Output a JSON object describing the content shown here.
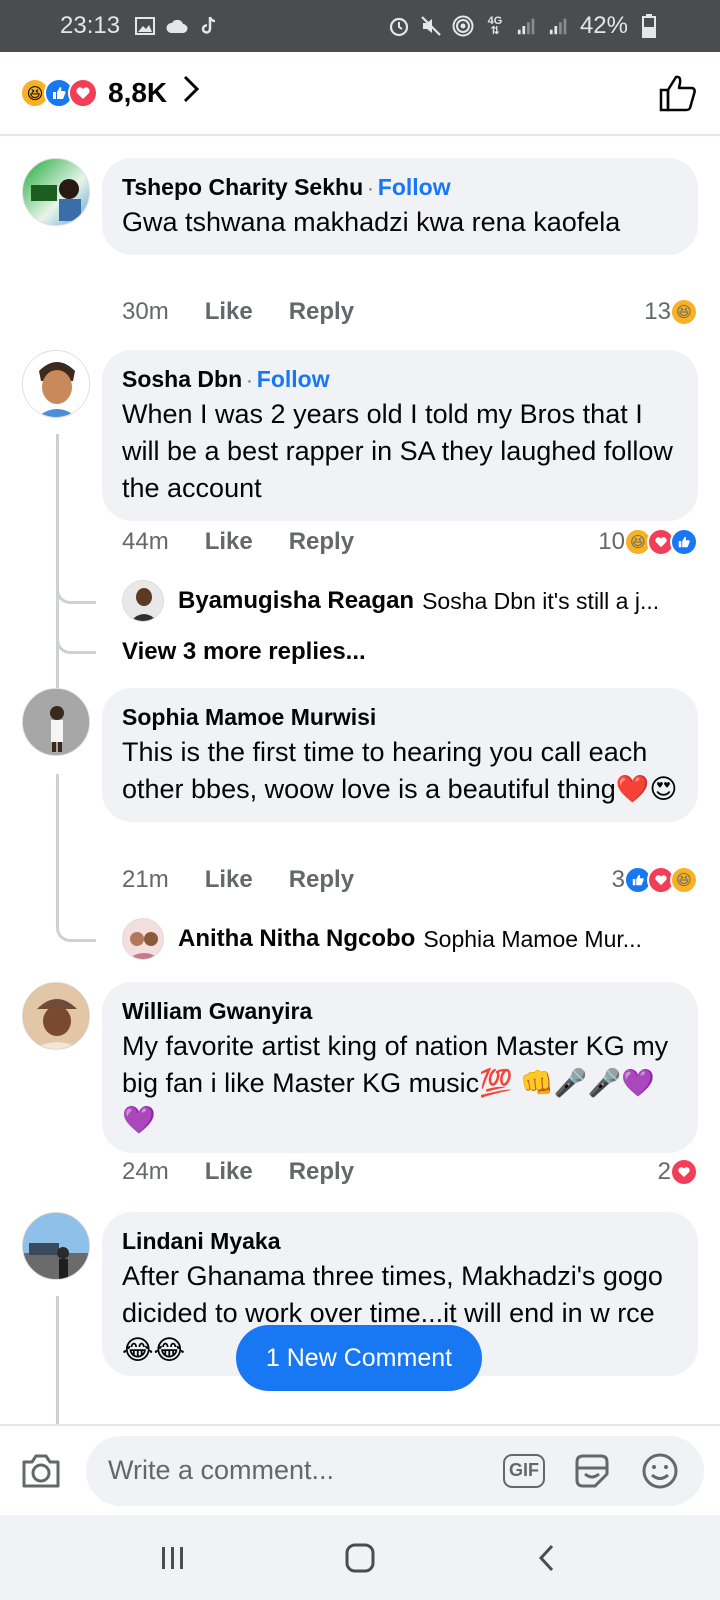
{
  "status_bar": {
    "time": "23:13",
    "battery": "42%",
    "network": "4G"
  },
  "header": {
    "reaction_count": "8,8K",
    "reaction_icons": [
      "haha-icon",
      "like-icon",
      "love-icon"
    ]
  },
  "comments": [
    {
      "author": "Tshepo Charity Sekhu",
      "follow": "Follow",
      "text": "Gwa tshwana makhadzi kwa rena kaofela",
      "time": "30m",
      "like": "Like",
      "reply": "Reply",
      "reaction_count": "13",
      "reactions": [
        "haha"
      ]
    },
    {
      "author": "Sosha Dbn",
      "follow": "Follow",
      "text": "When I was 2 years old I told my Bros that I will be a best rapper in SA they laughed follow the account",
      "time": "44m",
      "like": "Like",
      "reply": "Reply",
      "reaction_count": "10",
      "reactions": [
        "haha",
        "love",
        "like"
      ],
      "reply_preview": {
        "name": "Byamugisha Reagan",
        "snippet": "Sosha Dbn it's still a j..."
      },
      "more_replies": "View 3 more replies..."
    },
    {
      "author": "Sophia Mamoe Murwisi",
      "text": "This is the first time to hearing you call each other bbes, woow love is a beautiful thing❤️😍",
      "time": "21m",
      "like": "Like",
      "reply": "Reply",
      "reaction_count": "3",
      "reactions": [
        "like",
        "love",
        "haha"
      ],
      "reply_preview": {
        "name": "Anitha Nitha Ngcobo",
        "snippet": "Sophia Mamoe Mur..."
      }
    },
    {
      "author": "William Gwanyira",
      "text": "My favorite artist king of nation Master KG my big fan i like Master KG music💯 👊🎤🎤💜💜",
      "time": "24m",
      "like": "Like",
      "reply": "Reply",
      "reaction_count": "2",
      "reactions": [
        "love"
      ]
    },
    {
      "author": "Lindani Myaka",
      "text": "After Ghanama three times, Makhadzi's gogo dicided to work over time...it will end in w rce😂😂"
    }
  ],
  "new_comment_pill": "1 New Comment",
  "composer": {
    "placeholder": "Write a comment...",
    "gif_label": "GIF"
  }
}
